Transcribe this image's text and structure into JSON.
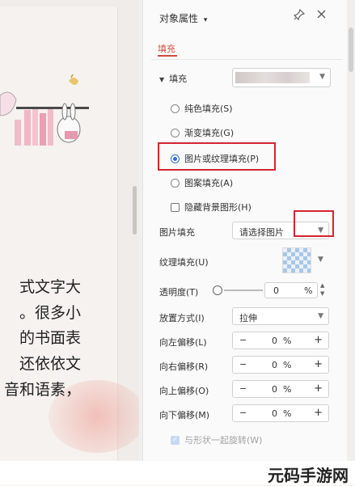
{
  "document": {
    "lines": [
      "式文字大",
      "。很多小",
      "的书面表",
      "还依依文",
      "音和语素，"
    ]
  },
  "panel": {
    "title": "对象属性",
    "title_chevron": "▾",
    "tab": "填充",
    "section": "填充",
    "radios": [
      {
        "label": "纯色填充(S)",
        "checked": false
      },
      {
        "label": "渐变填充(G)",
        "checked": false
      },
      {
        "label": "图片或纹理填充(P)",
        "checked": true
      },
      {
        "label": "图案填充(A)",
        "checked": false
      }
    ],
    "hide_bg_label": "隐藏背景图形(H)",
    "picture_fill": {
      "label": "图片填充",
      "value": "请选择图片"
    },
    "texture_fill": {
      "label": "纹理填充(U)"
    },
    "transparency": {
      "label": "透明度(T)",
      "value": "0",
      "unit": "%"
    },
    "placement": {
      "label": "放置方式(I)",
      "value": "拉伸"
    },
    "offsets": [
      {
        "label": "向左偏移(L)",
        "value": "0",
        "unit": "%"
      },
      {
        "label": "向右偏移(R)",
        "value": "0",
        "unit": "%"
      },
      {
        "label": "向上偏移(O)",
        "value": "0",
        "unit": "%"
      },
      {
        "label": "向下偏移(M)",
        "value": "0",
        "unit": "%"
      }
    ],
    "rotate_with_shape": "与形状一起旋转(W)",
    "minus": "−",
    "plus": "+"
  },
  "watermark": "元码手游网",
  "colors": {
    "accent": "#d04a3b",
    "highlight_box": "#d22630",
    "radio_on": "#2f6fd8"
  }
}
